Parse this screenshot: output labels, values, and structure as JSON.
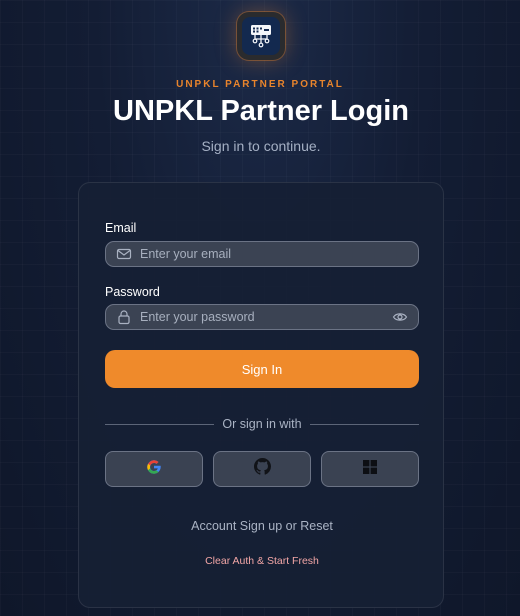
{
  "header": {
    "kicker": "UNPKL PARTNER PORTAL",
    "title": "UNPKL Partner Login",
    "subtitle": "Sign in to continue."
  },
  "form": {
    "email": {
      "label": "Email",
      "placeholder": "Enter your email",
      "value": ""
    },
    "password": {
      "label": "Password",
      "placeholder": "Enter your password",
      "value": ""
    },
    "submit_label": "Sign In"
  },
  "divider_text": "Or sign in with",
  "social": [
    {
      "icon": "google-icon"
    },
    {
      "icon": "github-icon"
    },
    {
      "icon": "microsoft-icon"
    }
  ],
  "links": {
    "account": "Account Sign up or Reset",
    "reset_auth": "Clear Auth & Start Fresh"
  },
  "colors": {
    "accent": "#ef8a2b",
    "background": "#0f172a",
    "card": "#162034",
    "danger_text": "#f2a6a6"
  }
}
